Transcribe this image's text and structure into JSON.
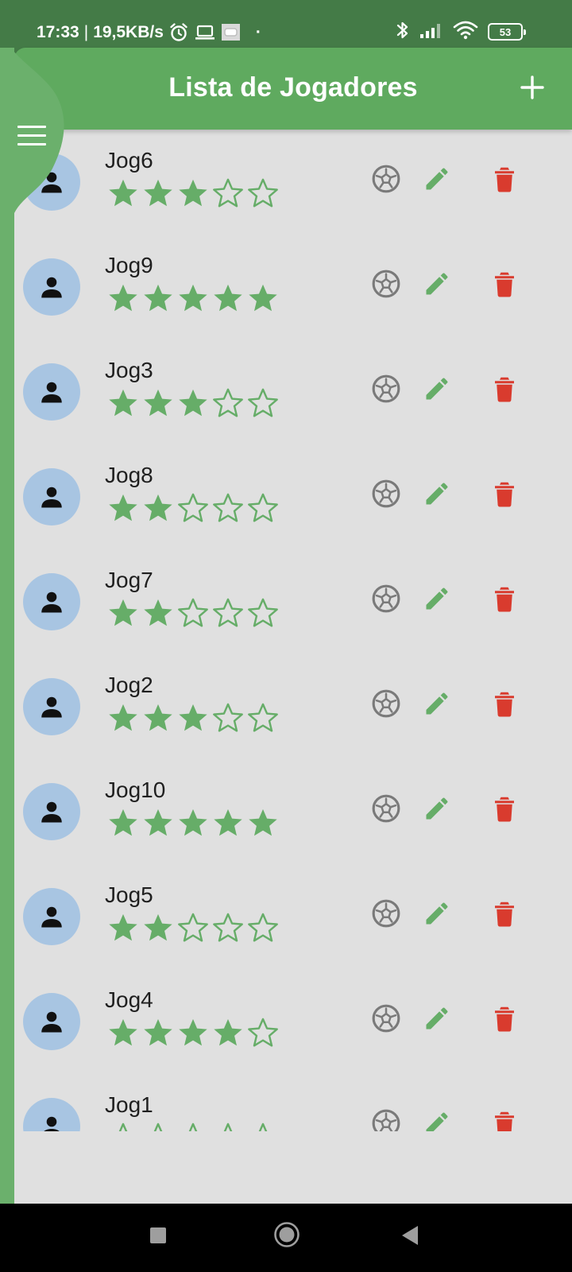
{
  "status_bar": {
    "time": "17:33",
    "separator": "|",
    "speed": "19,5KB/s",
    "dot": "·",
    "battery": "53",
    "icons": [
      "alarm-icon",
      "laptop-icon",
      "image-icon",
      "bluetooth-icon",
      "signal-icon",
      "wifi-icon",
      "battery-icon"
    ]
  },
  "app_bar": {
    "title": "Lista de Jogadores",
    "add_icon": "plus-icon",
    "menu_icon": "hamburger-menu-icon"
  },
  "players": [
    {
      "name": "Jog6",
      "rating": 3
    },
    {
      "name": "Jog9",
      "rating": 5
    },
    {
      "name": "Jog3",
      "rating": 3
    },
    {
      "name": "Jog8",
      "rating": 2
    },
    {
      "name": "Jog7",
      "rating": 2
    },
    {
      "name": "Jog2",
      "rating": 3
    },
    {
      "name": "Jog10",
      "rating": 5
    },
    {
      "name": "Jog5",
      "rating": 2
    },
    {
      "name": "Jog4",
      "rating": 4
    },
    {
      "name": "Jog1",
      "rating": 0
    }
  ],
  "rating_max": 5,
  "row_icons": [
    "person-icon",
    "soccer-ball-icon",
    "pencil-edit-icon",
    "trash-delete-icon"
  ],
  "nav_bar": {
    "icons": [
      "recents-square-icon",
      "home-circle-icon",
      "back-triangle-icon"
    ]
  },
  "colors": {
    "status_bar": "#447b47",
    "app_bar": "#5faa5f",
    "accent_green": "#66ad68",
    "delete_red": "#d93b2e",
    "ball_gray": "#7a7a7a",
    "avatar_bg": "#a8c5e2",
    "list_bg": "#e0e0e0"
  }
}
